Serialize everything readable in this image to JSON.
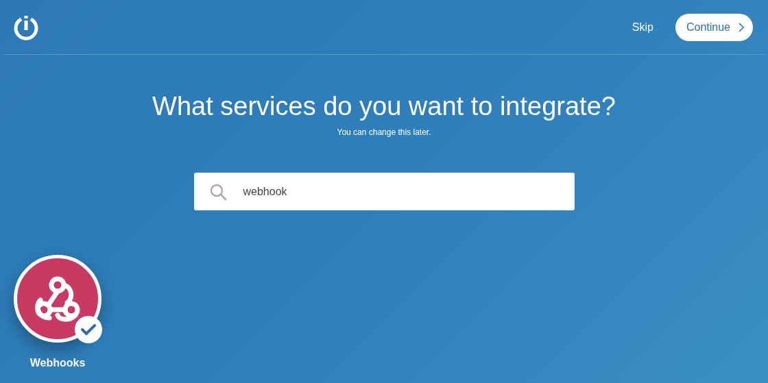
{
  "header": {
    "skip": "Skip",
    "continue": "Continue"
  },
  "title": "What services do you want to integrate?",
  "subtitle": "You can change this later.",
  "search": {
    "value": "webhook"
  },
  "services": [
    {
      "name": "Webhooks",
      "selected": true
    }
  ]
}
